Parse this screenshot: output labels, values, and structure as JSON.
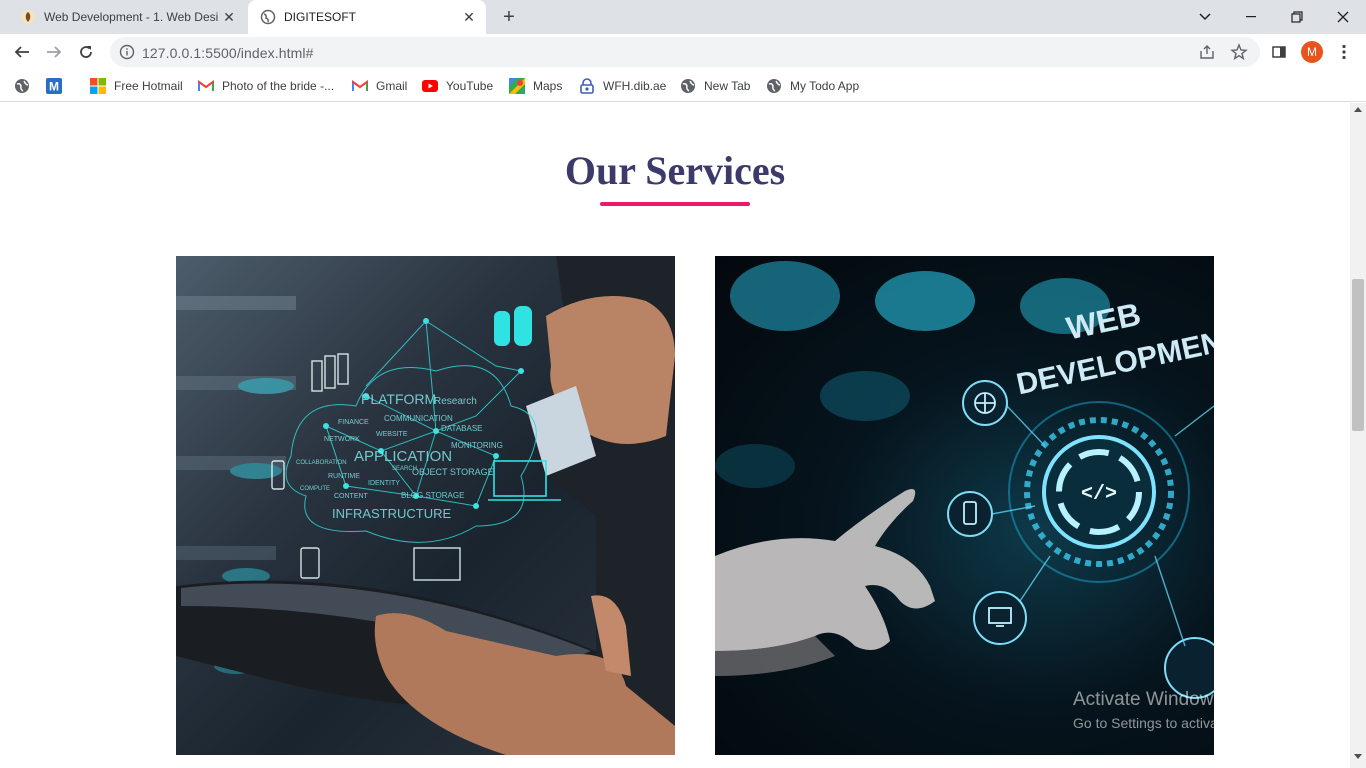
{
  "tabs": [
    {
      "title": "Web Development - 1. Web Desi",
      "active": false
    },
    {
      "title": "DIGITESOFT",
      "active": true
    }
  ],
  "address_bar": {
    "url": "127.0.0.1:5500/index.html#"
  },
  "profile": {
    "initial": "M",
    "color": "#e8541e"
  },
  "bookmarks": [
    {
      "label": "",
      "icon": "globe-icon"
    },
    {
      "label": "",
      "icon": "m-app-icon"
    },
    {
      "label": "Free Hotmail",
      "icon": "windows-logo-icon"
    },
    {
      "label": "Photo of the bride -...",
      "icon": "gmail-icon"
    },
    {
      "label": "Gmail",
      "icon": "gmail-icon"
    },
    {
      "label": "YouTube",
      "icon": "youtube-icon"
    },
    {
      "label": "Maps",
      "icon": "maps-icon"
    },
    {
      "label": "WFH.dib.ae",
      "icon": "lock-app-icon"
    },
    {
      "label": "New Tab",
      "icon": "globe-icon"
    },
    {
      "label": "My Todo App",
      "icon": "globe-icon"
    }
  ],
  "page": {
    "heading": "Our Services",
    "accent_color": "#ec1a67",
    "heading_color": "#3b3a6b",
    "service_images": [
      {
        "overlay_words": [
          "PLATFORM",
          "Research",
          "FINANCE",
          "COMMUNICATION",
          "NETWORK",
          "WEBSITE",
          "DATABASE",
          "APPLICATION",
          "MONITORING",
          "COLLABORATION",
          "RUNTIME",
          "SEARCH",
          "IDENTITY",
          "OBJECT STORAGE",
          "COMPUTE",
          "CONTENT",
          "BLOG STORAGE",
          "INFRASTRUCTURE"
        ]
      },
      {
        "overlay_words": [
          "WEB",
          "DEVELOPMENT",
          "</>"
        ]
      }
    ]
  },
  "watermark": {
    "line1": "Activate Windows",
    "line2": "Go to Settings to activate Windows."
  }
}
